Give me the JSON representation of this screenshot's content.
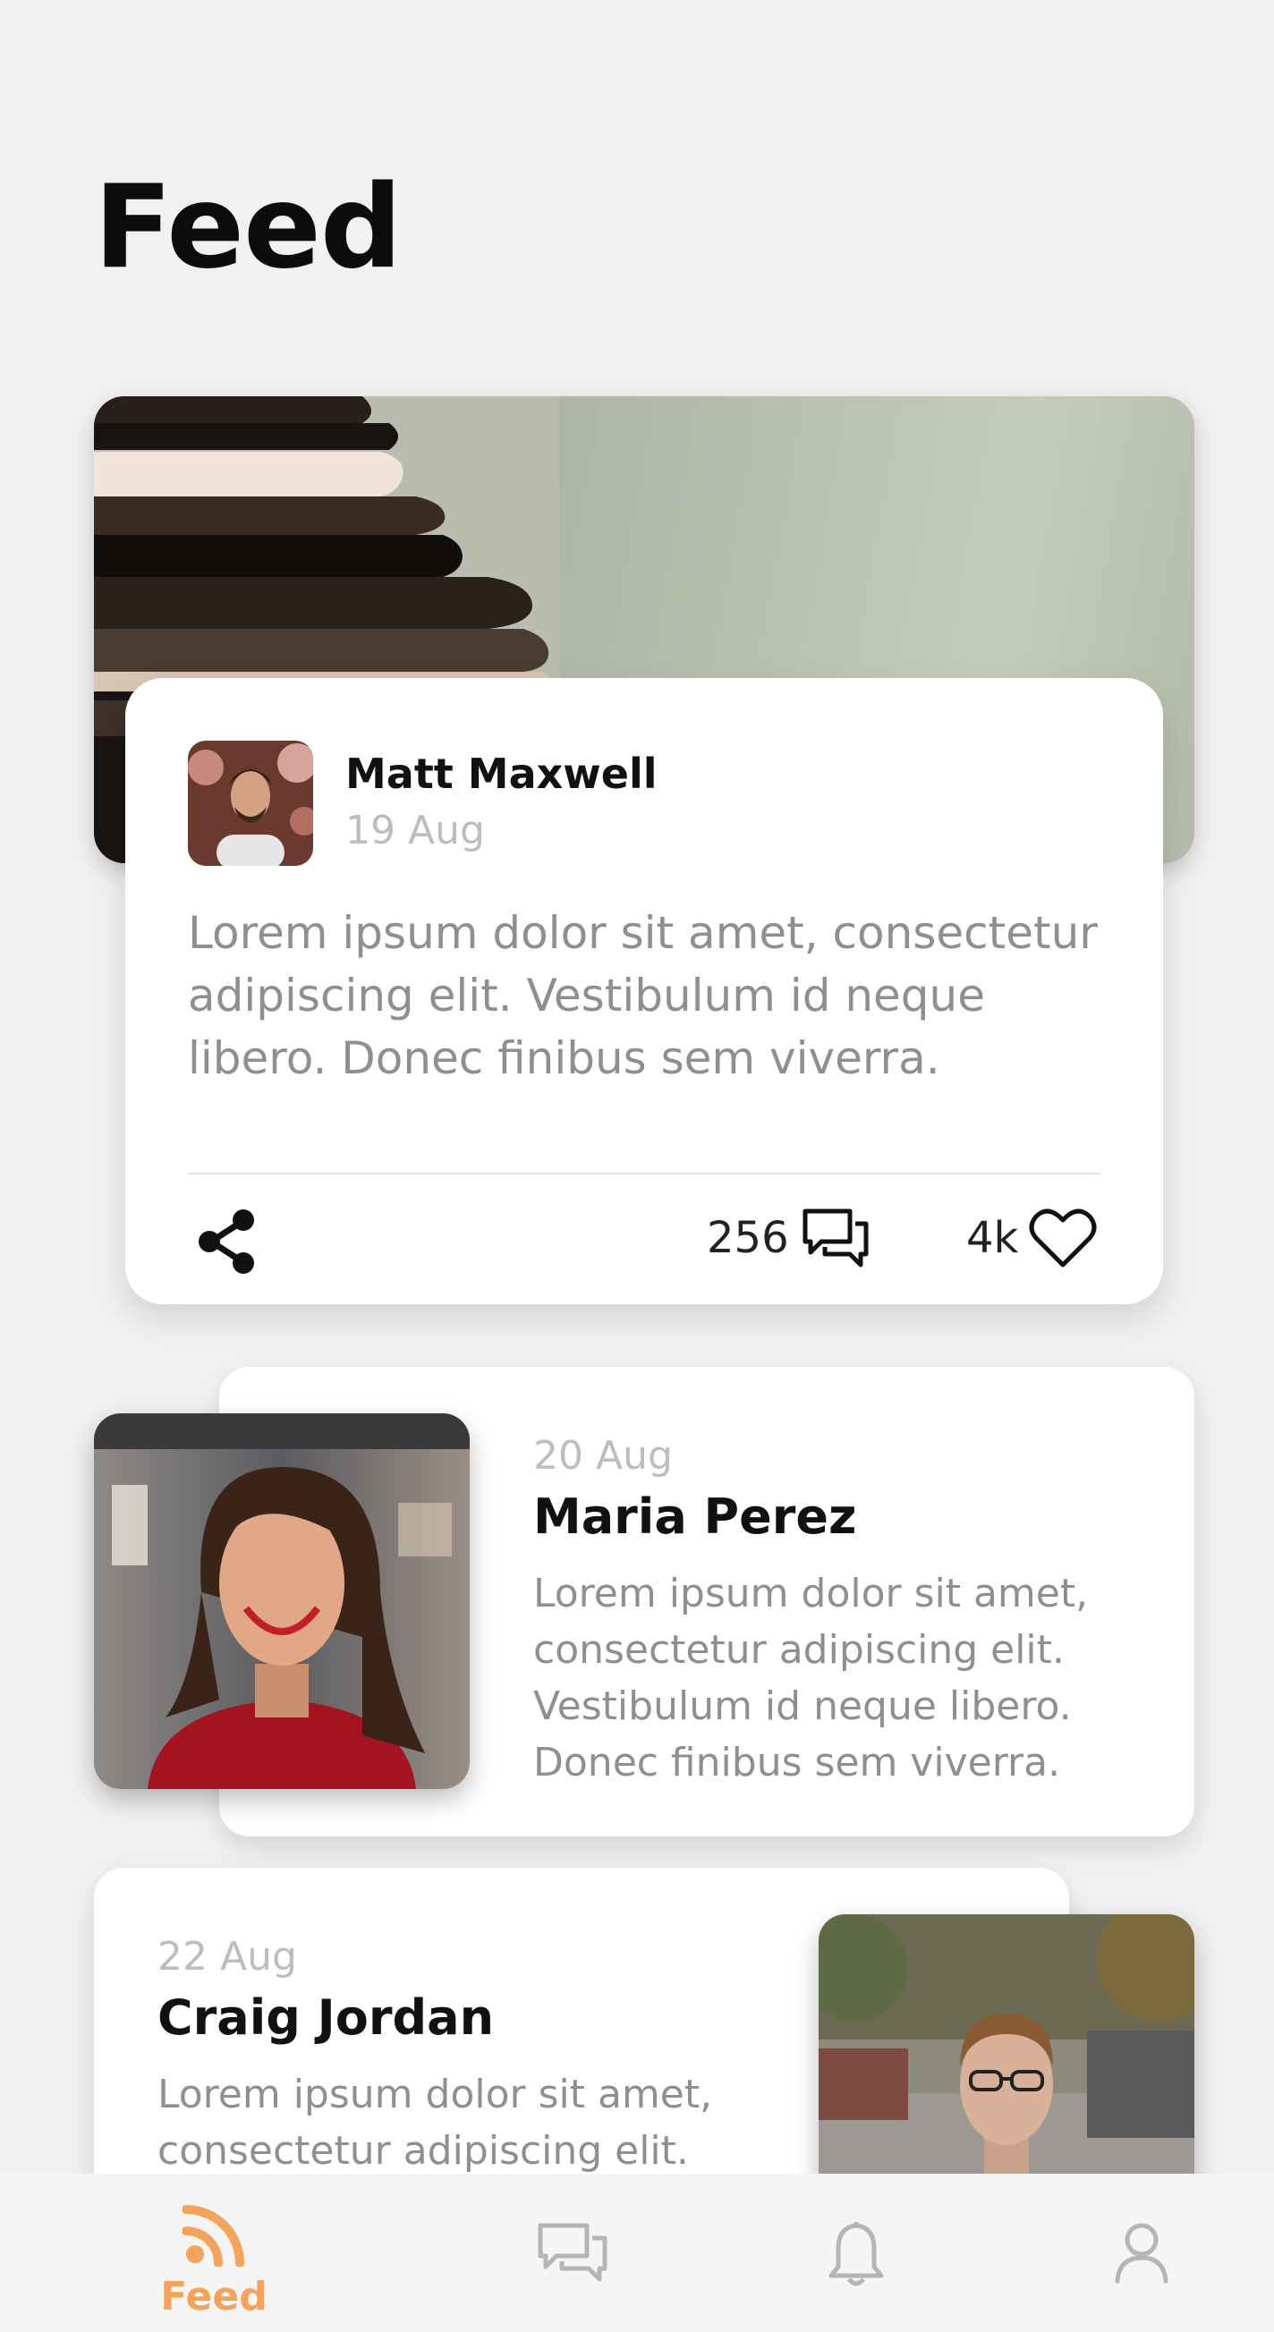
{
  "header": {
    "title": "Feed"
  },
  "featured_post": {
    "author": "Matt Maxwell",
    "date": "19 Aug",
    "body": "Lorem ipsum dolor sit amet, consectetur adipiscing elit. Vestibulum id neque libero. Donec finibus sem viverra.",
    "comments": "256",
    "likes": "4k",
    "icons": {
      "share": "share-icon",
      "comment": "comment-icon",
      "like": "heart-icon"
    }
  },
  "posts": [
    {
      "date": "20 Aug",
      "author": "Maria Perez",
      "body": "Lorem ipsum dolor sit amet, consectetur adipiscing elit. Vestibulum id neque libero. Donec finibus sem viverra."
    },
    {
      "date": "22 Aug",
      "author": "Craig Jordan",
      "body": "Lorem ipsum dolor sit amet, consectetur adipiscing elit."
    }
  ],
  "nav": {
    "active_color": "#f5a35b",
    "inactive_color": "#b5b5b5",
    "items": [
      {
        "label": "Feed",
        "icon": "rss-icon",
        "active": true
      },
      {
        "label": "",
        "icon": "chat-icon",
        "active": false
      },
      {
        "label": "",
        "icon": "bell-icon",
        "active": false
      },
      {
        "label": "",
        "icon": "user-icon",
        "active": false
      }
    ]
  }
}
